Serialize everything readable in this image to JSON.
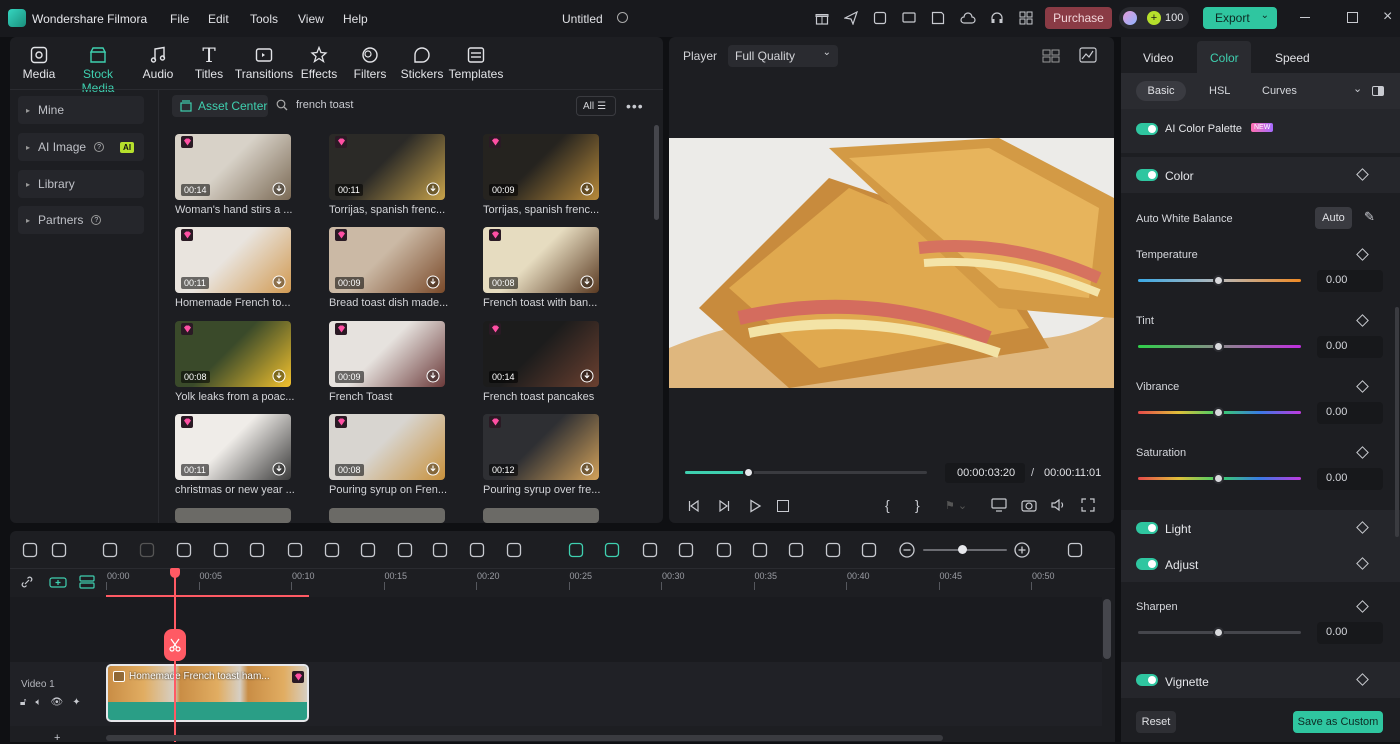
{
  "app": {
    "name": "Wondershare Filmora",
    "project_title": "Untitled"
  },
  "menu": [
    "File",
    "Edit",
    "Tools",
    "View",
    "Help"
  ],
  "header": {
    "purchase_label": "Purchase",
    "credits": "100",
    "export_label": "Export"
  },
  "tabs": [
    {
      "label": "Media",
      "icon": "media-icon"
    },
    {
      "label": "Stock Media",
      "icon": "stock-media-icon",
      "active": true
    },
    {
      "label": "Audio",
      "icon": "music-note-icon"
    },
    {
      "label": "Titles",
      "icon": "titles-T-icon"
    },
    {
      "label": "Transitions",
      "icon": "transitions-icon"
    },
    {
      "label": "Effects",
      "icon": "effects-icon"
    },
    {
      "label": "Filters",
      "icon": "filters-icon"
    },
    {
      "label": "Stickers",
      "icon": "stickers-icon"
    },
    {
      "label": "Templates",
      "icon": "templates-icon"
    }
  ],
  "sidebar": [
    {
      "label": "Mine"
    },
    {
      "label": "AI Image",
      "badge": "AI"
    },
    {
      "label": "Library"
    },
    {
      "label": "Partners"
    }
  ],
  "asset_bar": {
    "asset_center_label": "Asset Center",
    "search_value": "french toast",
    "filter_label": "All"
  },
  "assets": [
    {
      "duration": "00:14",
      "caption": "Woman's hand stirs a ...",
      "colors": [
        "#d8d2c8",
        "#7b6a55"
      ]
    },
    {
      "duration": "00:11",
      "caption": "Torrijas, spanish frenc...",
      "colors": [
        "#2b2a27",
        "#c7a24a"
      ]
    },
    {
      "duration": "00:09",
      "caption": "Torrijas, spanish frenc...",
      "colors": [
        "#25231f",
        "#b88a3a"
      ]
    },
    {
      "duration": "00:11",
      "caption": "Homemade French to...",
      "colors": [
        "#e9e4de",
        "#d19a52"
      ]
    },
    {
      "duration": "00:09",
      "caption": "Bread toast dish made...",
      "colors": [
        "#cbb9a5",
        "#7a4a2a"
      ]
    },
    {
      "duration": "00:08",
      "caption": "French toast with ban...",
      "colors": [
        "#e6dcc0",
        "#5a3a22"
      ]
    },
    {
      "duration": "00:08",
      "caption": "Yolk leaks from a poac...",
      "colors": [
        "#3a4a2a",
        "#f2c12e"
      ]
    },
    {
      "duration": "00:09",
      "caption": "French Toast",
      "colors": [
        "#e6e2de",
        "#6b3a3a"
      ]
    },
    {
      "duration": "00:14",
      "caption": "French toast pancakes",
      "colors": [
        "#1c1c1c",
        "#6b4030"
      ]
    },
    {
      "duration": "00:11",
      "caption": "christmas or new year ...",
      "colors": [
        "#efece8",
        "#3b3b3b"
      ]
    },
    {
      "duration": "00:08",
      "caption": "Pouring syrup on Fren...",
      "colors": [
        "#d8d5d0",
        "#c8913c"
      ]
    },
    {
      "duration": "00:12",
      "caption": "Pouring syrup over fre...",
      "colors": [
        "#2e2f33",
        "#d3a25a"
      ]
    }
  ],
  "player": {
    "label": "Player",
    "quality": "Full Quality",
    "current_time": "00:00:03:20",
    "total_time": "00:00:11:01",
    "progress": 0.26
  },
  "properties": {
    "tabs": [
      "Video",
      "Color",
      "Speed"
    ],
    "active_tab": "Color",
    "subtabs": [
      "Basic",
      "HSL",
      "Curves"
    ],
    "ai_palette_label": "AI Color Palette",
    "new_badge": "NEW",
    "color_label": "Color",
    "awb_label": "Auto White Balance",
    "auto_label": "Auto",
    "sliders": [
      {
        "label": "Temperature",
        "value": "0.00"
      },
      {
        "label": "Tint",
        "value": "0.00"
      },
      {
        "label": "Vibrance",
        "value": "0.00"
      },
      {
        "label": "Saturation",
        "value": "0.00"
      }
    ],
    "light_label": "Light",
    "adjust_label": "Adjust",
    "sharpen_label": "Sharpen",
    "sharpen_value": "0.00",
    "vignette_label": "Vignette",
    "reset_label": "Reset",
    "save_custom_label": "Save as Custom"
  },
  "timeline": {
    "ruler": [
      "00:00",
      "00:05",
      "00:10",
      "00:15",
      "00:20",
      "00:25",
      "00:30",
      "00:35",
      "00:40",
      "00:45",
      "00:50"
    ],
    "track_label": "Video 1",
    "clip_label": "Homemade French toast ham..."
  },
  "colors": {
    "accent": "#2fc6a0",
    "purchase": "#8a3b45",
    "export": "#2fc6a0",
    "playhead": "#ff5a64"
  }
}
